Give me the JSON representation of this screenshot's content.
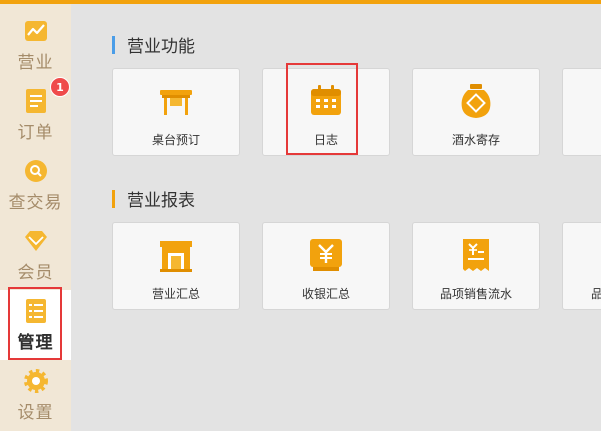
{
  "colors": {
    "accent": "#f2a20d",
    "highlight": "#e53939",
    "sidebar_bg": "#f1e7d6"
  },
  "sidebar": {
    "items": [
      {
        "label": "营业",
        "icon": "chart-icon"
      },
      {
        "label": "订单",
        "icon": "order-list-icon",
        "badge": "1"
      },
      {
        "label": "查交易",
        "icon": "search-icon"
      },
      {
        "label": "会员",
        "icon": "diamond-icon"
      },
      {
        "label": "管理",
        "icon": "checklist-icon",
        "active": true
      },
      {
        "label": "设置",
        "icon": "gear-icon"
      }
    ]
  },
  "sections": [
    {
      "title": "营业功能",
      "cards": [
        {
          "label": "桌台预订",
          "icon": "table-icon"
        },
        {
          "label": "日志",
          "icon": "calendar-icon"
        },
        {
          "label": "酒水寄存",
          "icon": "wine-jar-icon"
        }
      ]
    },
    {
      "title": "营业报表",
      "cards": [
        {
          "label": "营业汇总",
          "icon": "shop-icon"
        },
        {
          "label": "收银汇总",
          "icon": "yuan-icon"
        },
        {
          "label": "品项销售流水",
          "icon": "receipt-icon"
        },
        {
          "label": "品",
          "icon": ""
        }
      ]
    }
  ]
}
